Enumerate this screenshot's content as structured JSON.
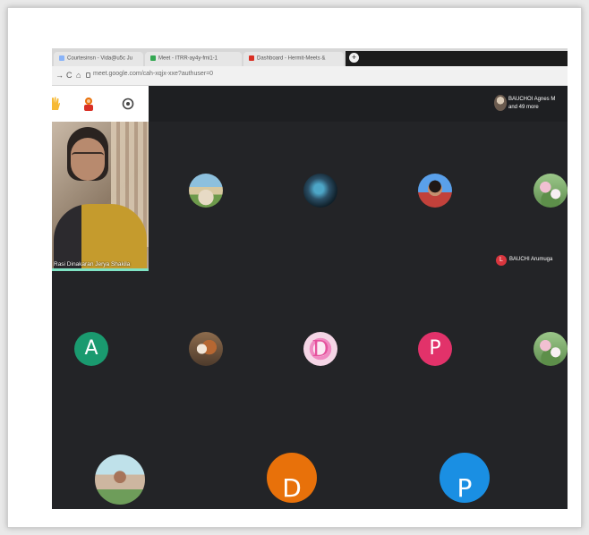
{
  "browser": {
    "tabs": [
      {
        "label": "Courtesinsn - Vida@u5c Ju",
        "favicon_color": "#8ab4f8"
      },
      {
        "label": "Meet - ITRR-ay4y-fmi1-1",
        "favicon_color": "#34a853"
      },
      {
        "label": "Dashboard - Hermit-Meets &",
        "favicon_color": "#d93025"
      }
    ],
    "new_tab_icon": "+",
    "nav": {
      "back": "→",
      "reload": "C",
      "home": "⌂"
    },
    "url": "meet.google.com/cah-xqjx-xxe?authuser=0"
  },
  "meet": {
    "toolbar_icons": [
      "raise-hand-icon",
      "activities-icon",
      "settings-icon"
    ],
    "presenter": {
      "name": "BAUCHOI Agnes M",
      "more": "and 49 more"
    },
    "self_view": {
      "name": "Rasi Dinakaran Jerya Shakila"
    },
    "speaking_pill": {
      "initial": "L",
      "name": "BAUCHI Arumuga"
    },
    "participants": [
      {
        "kind": "photo",
        "photo": "temple"
      },
      {
        "kind": "photo",
        "photo": "earth"
      },
      {
        "kind": "photo",
        "photo": "lady"
      },
      {
        "kind": "photo",
        "photo": "flowers"
      },
      {
        "kind": "letter",
        "letter": "A",
        "color": "#1a9a6f"
      },
      {
        "kind": "photo",
        "photo": "dog"
      },
      {
        "kind": "letter-photo",
        "letter": "D",
        "photo": "d"
      },
      {
        "kind": "letter",
        "letter": "P",
        "color": "#e2326a"
      },
      {
        "kind": "photo",
        "photo": "flowers"
      },
      {
        "kind": "photo",
        "photo": "girl"
      },
      {
        "kind": "letter",
        "letter": "D",
        "color": "#e8710a"
      },
      {
        "kind": "letter",
        "letter": "P",
        "color": "#1a8fe3"
      }
    ]
  }
}
